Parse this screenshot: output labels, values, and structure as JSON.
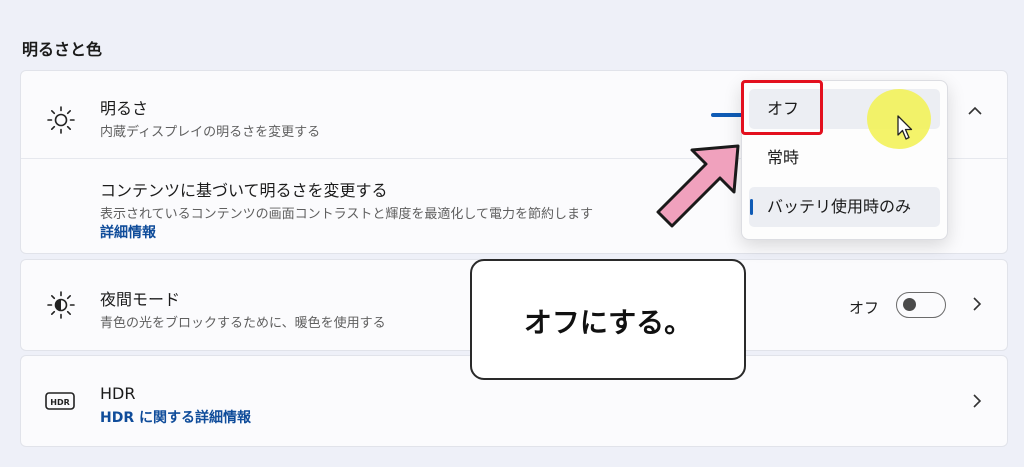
{
  "section": {
    "title": "明るさと色"
  },
  "brightness": {
    "title": "明るさ",
    "subtitle": "内蔵ディスプレイの明るさを変更する",
    "icon": "sun-icon"
  },
  "content_adaptive": {
    "title": "コンテンツに基づいて明るさを変更する",
    "subtitle": "表示されているコンテンツの画面コントラストと輝度を最適化して電力を節約します",
    "link": "詳細情報"
  },
  "dropdown": {
    "options": [
      "オフ",
      "常時",
      "バッテリ使用時のみ"
    ],
    "selected": "バッテリ使用時のみ",
    "hovered": "オフ"
  },
  "night_light": {
    "title": "夜間モード",
    "subtitle": "青色の光をブロックするために、暖色を使用する",
    "state_label": "オフ",
    "icon": "night-light-icon"
  },
  "hdr": {
    "title": "HDR",
    "link": "HDR に関する詳細情報",
    "icon": "hdr-icon"
  },
  "callout": {
    "text": "オフにする。"
  },
  "colors": {
    "accent": "#0f5bb5",
    "highlight_box": "#e3101e",
    "arrow": "#f0a1bd"
  }
}
